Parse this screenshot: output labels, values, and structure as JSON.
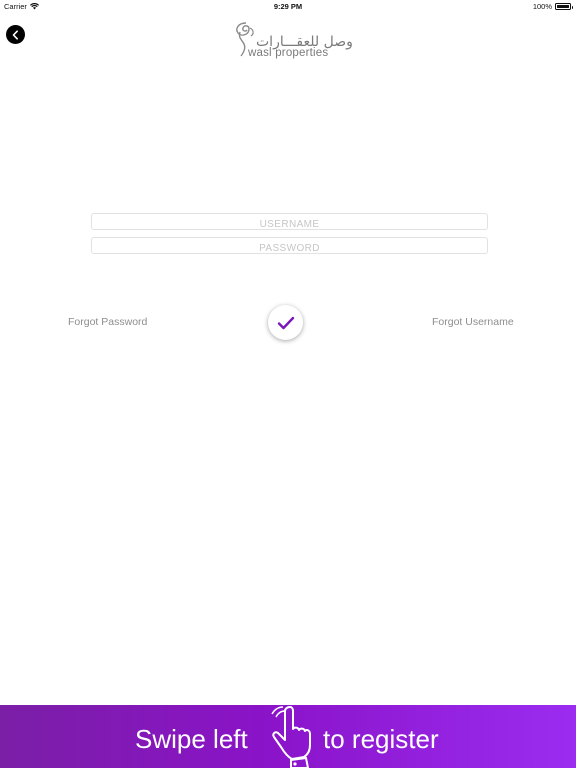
{
  "status_bar": {
    "carrier": "Carrier",
    "time": "9:29 PM",
    "battery": "100%",
    "icons": [
      "wifi-icon",
      "battery-icon"
    ]
  },
  "header": {
    "back_icon": "chevron-left-icon",
    "logo": {
      "arabic": "وصل للعقـــارات",
      "latin": "wasl properties"
    }
  },
  "form": {
    "username": {
      "value": "",
      "placeholder": "USERNAME"
    },
    "password": {
      "value": "",
      "placeholder": "PASSWORD"
    },
    "forgot_password": "Forgot Password",
    "forgot_username": "Forgot Username",
    "submit_icon": "checkmark-icon"
  },
  "banner": {
    "left_text": "Swipe left",
    "right_text": "to register",
    "icon": "hand-swipe-icon"
  },
  "colors": {
    "accent": "#8a13c8",
    "banner_start": "#7b1fa6",
    "banner_end": "#9b2cf0",
    "checkmark": "#7b16b8"
  }
}
